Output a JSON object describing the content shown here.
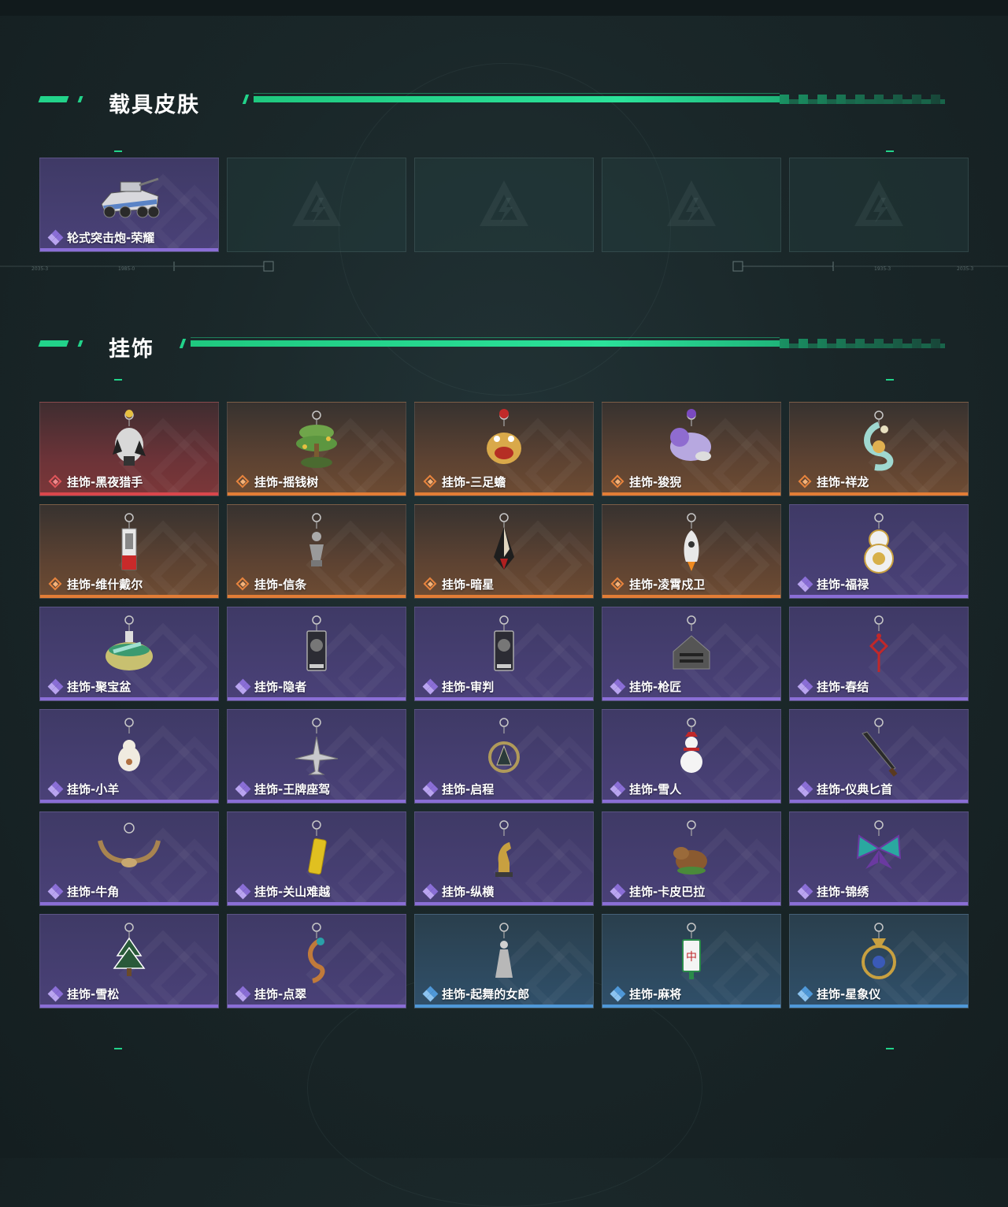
{
  "sections": {
    "vehicle_skins": {
      "title": "载具皮肤",
      "items": [
        {
          "name": "轮式突击炮-荣耀",
          "rarity": "purple",
          "icon": "armored-vehicle-icon"
        }
      ],
      "empty_slots": 4
    },
    "pendants": {
      "title": "挂饰",
      "items": [
        {
          "name": "挂饰-黑夜猎手",
          "rarity": "red",
          "icon": "night-hunter-figure-icon"
        },
        {
          "name": "挂饰-摇钱树",
          "rarity": "orange",
          "icon": "money-tree-icon"
        },
        {
          "name": "挂饰-三足蟾",
          "rarity": "orange",
          "icon": "three-legged-toad-icon"
        },
        {
          "name": "挂饰-狻猊",
          "rarity": "orange",
          "icon": "suanni-lion-icon"
        },
        {
          "name": "挂饰-祥龙",
          "rarity": "orange",
          "icon": "dragon-icon"
        },
        {
          "name": "挂饰-维什戴尔",
          "rarity": "orange",
          "icon": "tag-pendant-icon"
        },
        {
          "name": "挂饰-信条",
          "rarity": "orange",
          "icon": "figurine-icon"
        },
        {
          "name": "挂饰-暗星",
          "rarity": "orange",
          "icon": "dark-star-icon"
        },
        {
          "name": "挂饰-凌霄戍卫",
          "rarity": "orange",
          "icon": "rocket-icon"
        },
        {
          "name": "挂饰-福禄",
          "rarity": "purple",
          "icon": "gourd-icon"
        },
        {
          "name": "挂饰-聚宝盆",
          "rarity": "purple",
          "icon": "treasure-bowl-icon"
        },
        {
          "name": "挂饰-隐者",
          "rarity": "purple",
          "icon": "tarot-card-icon"
        },
        {
          "name": "挂饰-审判",
          "rarity": "purple",
          "icon": "tarot-card-icon"
        },
        {
          "name": "挂饰-枪匠",
          "rarity": "purple",
          "icon": "gun-house-icon"
        },
        {
          "name": "挂饰-春结",
          "rarity": "purple",
          "icon": "chinese-knot-icon"
        },
        {
          "name": "挂饰-小羊",
          "rarity": "purple",
          "icon": "lamb-icon"
        },
        {
          "name": "挂饰-王牌座驾",
          "rarity": "purple",
          "icon": "jet-plane-icon"
        },
        {
          "name": "挂饰-启程",
          "rarity": "purple",
          "icon": "medallion-icon"
        },
        {
          "name": "挂饰-雪人",
          "rarity": "purple",
          "icon": "snowman-icon"
        },
        {
          "name": "挂饰-仪典匕首",
          "rarity": "purple",
          "icon": "dagger-icon"
        },
        {
          "name": "挂饰-牛角",
          "rarity": "purple",
          "icon": "bull-horns-icon"
        },
        {
          "name": "挂饰-关山难越",
          "rarity": "purple",
          "icon": "gold-bar-icon"
        },
        {
          "name": "挂饰-纵横",
          "rarity": "purple",
          "icon": "chess-knight-icon"
        },
        {
          "name": "挂饰-卡皮巴拉",
          "rarity": "purple",
          "icon": "capybara-icon"
        },
        {
          "name": "挂饰-锦绣",
          "rarity": "purple",
          "icon": "butterfly-icon"
        },
        {
          "name": "挂饰-雪松",
          "rarity": "purple",
          "icon": "pine-tree-icon"
        },
        {
          "name": "挂饰-点翠",
          "rarity": "purple",
          "icon": "phoenix-icon"
        },
        {
          "name": "挂饰-起舞的女郎",
          "rarity": "blue",
          "icon": "dancer-icon"
        },
        {
          "name": "挂饰-麻将",
          "rarity": "blue",
          "icon": "mahjong-tile-icon"
        },
        {
          "name": "挂饰-星象仪",
          "rarity": "blue",
          "icon": "astrolabe-icon"
        }
      ]
    }
  },
  "mahjong_text": "中",
  "ruler_labels": [
    "2035-3",
    "1985-0",
    "1935-3",
    "2035-3"
  ],
  "colors": {
    "accent_green": "#22d38a",
    "rarity_red": "#d9474c",
    "rarity_orange": "#e27d36",
    "rarity_purple": "#8a6ed6",
    "rarity_blue": "#4f98d8"
  }
}
